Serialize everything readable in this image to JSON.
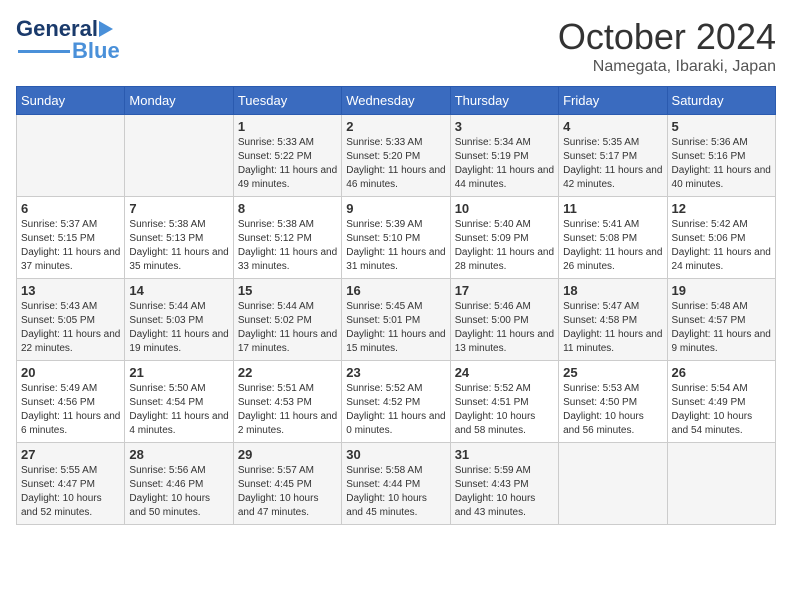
{
  "header": {
    "logo_general": "General",
    "logo_blue": "Blue",
    "month_title": "October 2024",
    "location": "Namegata, Ibaraki, Japan"
  },
  "weekdays": [
    "Sunday",
    "Monday",
    "Tuesday",
    "Wednesday",
    "Thursday",
    "Friday",
    "Saturday"
  ],
  "weeks": [
    [
      {
        "day": "",
        "sunrise": "",
        "sunset": "",
        "daylight": ""
      },
      {
        "day": "",
        "sunrise": "",
        "sunset": "",
        "daylight": ""
      },
      {
        "day": "1",
        "sunrise": "Sunrise: 5:33 AM",
        "sunset": "Sunset: 5:22 PM",
        "daylight": "Daylight: 11 hours and 49 minutes."
      },
      {
        "day": "2",
        "sunrise": "Sunrise: 5:33 AM",
        "sunset": "Sunset: 5:20 PM",
        "daylight": "Daylight: 11 hours and 46 minutes."
      },
      {
        "day": "3",
        "sunrise": "Sunrise: 5:34 AM",
        "sunset": "Sunset: 5:19 PM",
        "daylight": "Daylight: 11 hours and 44 minutes."
      },
      {
        "day": "4",
        "sunrise": "Sunrise: 5:35 AM",
        "sunset": "Sunset: 5:17 PM",
        "daylight": "Daylight: 11 hours and 42 minutes."
      },
      {
        "day": "5",
        "sunrise": "Sunrise: 5:36 AM",
        "sunset": "Sunset: 5:16 PM",
        "daylight": "Daylight: 11 hours and 40 minutes."
      }
    ],
    [
      {
        "day": "6",
        "sunrise": "Sunrise: 5:37 AM",
        "sunset": "Sunset: 5:15 PM",
        "daylight": "Daylight: 11 hours and 37 minutes."
      },
      {
        "day": "7",
        "sunrise": "Sunrise: 5:38 AM",
        "sunset": "Sunset: 5:13 PM",
        "daylight": "Daylight: 11 hours and 35 minutes."
      },
      {
        "day": "8",
        "sunrise": "Sunrise: 5:38 AM",
        "sunset": "Sunset: 5:12 PM",
        "daylight": "Daylight: 11 hours and 33 minutes."
      },
      {
        "day": "9",
        "sunrise": "Sunrise: 5:39 AM",
        "sunset": "Sunset: 5:10 PM",
        "daylight": "Daylight: 11 hours and 31 minutes."
      },
      {
        "day": "10",
        "sunrise": "Sunrise: 5:40 AM",
        "sunset": "Sunset: 5:09 PM",
        "daylight": "Daylight: 11 hours and 28 minutes."
      },
      {
        "day": "11",
        "sunrise": "Sunrise: 5:41 AM",
        "sunset": "Sunset: 5:08 PM",
        "daylight": "Daylight: 11 hours and 26 minutes."
      },
      {
        "day": "12",
        "sunrise": "Sunrise: 5:42 AM",
        "sunset": "Sunset: 5:06 PM",
        "daylight": "Daylight: 11 hours and 24 minutes."
      }
    ],
    [
      {
        "day": "13",
        "sunrise": "Sunrise: 5:43 AM",
        "sunset": "Sunset: 5:05 PM",
        "daylight": "Daylight: 11 hours and 22 minutes."
      },
      {
        "day": "14",
        "sunrise": "Sunrise: 5:44 AM",
        "sunset": "Sunset: 5:03 PM",
        "daylight": "Daylight: 11 hours and 19 minutes."
      },
      {
        "day": "15",
        "sunrise": "Sunrise: 5:44 AM",
        "sunset": "Sunset: 5:02 PM",
        "daylight": "Daylight: 11 hours and 17 minutes."
      },
      {
        "day": "16",
        "sunrise": "Sunrise: 5:45 AM",
        "sunset": "Sunset: 5:01 PM",
        "daylight": "Daylight: 11 hours and 15 minutes."
      },
      {
        "day": "17",
        "sunrise": "Sunrise: 5:46 AM",
        "sunset": "Sunset: 5:00 PM",
        "daylight": "Daylight: 11 hours and 13 minutes."
      },
      {
        "day": "18",
        "sunrise": "Sunrise: 5:47 AM",
        "sunset": "Sunset: 4:58 PM",
        "daylight": "Daylight: 11 hours and 11 minutes."
      },
      {
        "day": "19",
        "sunrise": "Sunrise: 5:48 AM",
        "sunset": "Sunset: 4:57 PM",
        "daylight": "Daylight: 11 hours and 9 minutes."
      }
    ],
    [
      {
        "day": "20",
        "sunrise": "Sunrise: 5:49 AM",
        "sunset": "Sunset: 4:56 PM",
        "daylight": "Daylight: 11 hours and 6 minutes."
      },
      {
        "day": "21",
        "sunrise": "Sunrise: 5:50 AM",
        "sunset": "Sunset: 4:54 PM",
        "daylight": "Daylight: 11 hours and 4 minutes."
      },
      {
        "day": "22",
        "sunrise": "Sunrise: 5:51 AM",
        "sunset": "Sunset: 4:53 PM",
        "daylight": "Daylight: 11 hours and 2 minutes."
      },
      {
        "day": "23",
        "sunrise": "Sunrise: 5:52 AM",
        "sunset": "Sunset: 4:52 PM",
        "daylight": "Daylight: 11 hours and 0 minutes."
      },
      {
        "day": "24",
        "sunrise": "Sunrise: 5:52 AM",
        "sunset": "Sunset: 4:51 PM",
        "daylight": "Daylight: 10 hours and 58 minutes."
      },
      {
        "day": "25",
        "sunrise": "Sunrise: 5:53 AM",
        "sunset": "Sunset: 4:50 PM",
        "daylight": "Daylight: 10 hours and 56 minutes."
      },
      {
        "day": "26",
        "sunrise": "Sunrise: 5:54 AM",
        "sunset": "Sunset: 4:49 PM",
        "daylight": "Daylight: 10 hours and 54 minutes."
      }
    ],
    [
      {
        "day": "27",
        "sunrise": "Sunrise: 5:55 AM",
        "sunset": "Sunset: 4:47 PM",
        "daylight": "Daylight: 10 hours and 52 minutes."
      },
      {
        "day": "28",
        "sunrise": "Sunrise: 5:56 AM",
        "sunset": "Sunset: 4:46 PM",
        "daylight": "Daylight: 10 hours and 50 minutes."
      },
      {
        "day": "29",
        "sunrise": "Sunrise: 5:57 AM",
        "sunset": "Sunset: 4:45 PM",
        "daylight": "Daylight: 10 hours and 47 minutes."
      },
      {
        "day": "30",
        "sunrise": "Sunrise: 5:58 AM",
        "sunset": "Sunset: 4:44 PM",
        "daylight": "Daylight: 10 hours and 45 minutes."
      },
      {
        "day": "31",
        "sunrise": "Sunrise: 5:59 AM",
        "sunset": "Sunset: 4:43 PM",
        "daylight": "Daylight: 10 hours and 43 minutes."
      },
      {
        "day": "",
        "sunrise": "",
        "sunset": "",
        "daylight": ""
      },
      {
        "day": "",
        "sunrise": "",
        "sunset": "",
        "daylight": ""
      }
    ]
  ]
}
